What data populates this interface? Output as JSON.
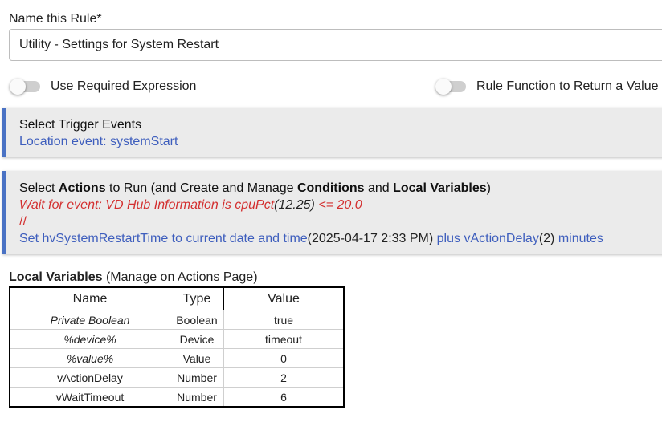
{
  "rule_name": {
    "label": "Name this Rule*",
    "value": "Utility - Settings for System Restart"
  },
  "toggles": {
    "required_expression": {
      "label": "Use Required Expression",
      "checked": false
    },
    "return_value": {
      "label": "Rule Function to Return a Value",
      "checked": false
    }
  },
  "triggers": {
    "title": "Select Trigger Events",
    "event": "Location event: systemStart"
  },
  "actions": {
    "title_parts": {
      "p1": "Select ",
      "b1": "Actions",
      "p2": " to Run (and Create and Manage ",
      "b2": "Conditions",
      "p3": " and ",
      "b3": "Local Variables",
      "p4": ")"
    },
    "line1": {
      "a": "Wait for event: VD Hub Information is cpuPct",
      "b": "(12.25)",
      "c": " <= 20.0"
    },
    "line2": "//",
    "line3": {
      "a": "Set hvSystemRestartTime to current date and time",
      "b": "(2025-04-17 2:33 PM)",
      "c": " plus vActionDelay",
      "d": "(2)",
      "e": " minutes"
    }
  },
  "local_variables": {
    "heading": "Local Variables",
    "subheading": " (Manage on Actions Page)",
    "columns": [
      "Name",
      "Type",
      "Value"
    ],
    "rows": [
      [
        "Private Boolean",
        "Boolean",
        "true"
      ],
      [
        "%device%",
        "Device",
        "timeout"
      ],
      [
        "%value%",
        "Value",
        "0"
      ],
      [
        "vActionDelay",
        "Number",
        "2"
      ],
      [
        "vWaitTimeout",
        "Number",
        "6"
      ]
    ]
  },
  "colors": {
    "accent": "#4a72c4",
    "link": "#3e5ebd",
    "wait_red": "#d32f2f",
    "card_bg": "#ebebeb"
  }
}
